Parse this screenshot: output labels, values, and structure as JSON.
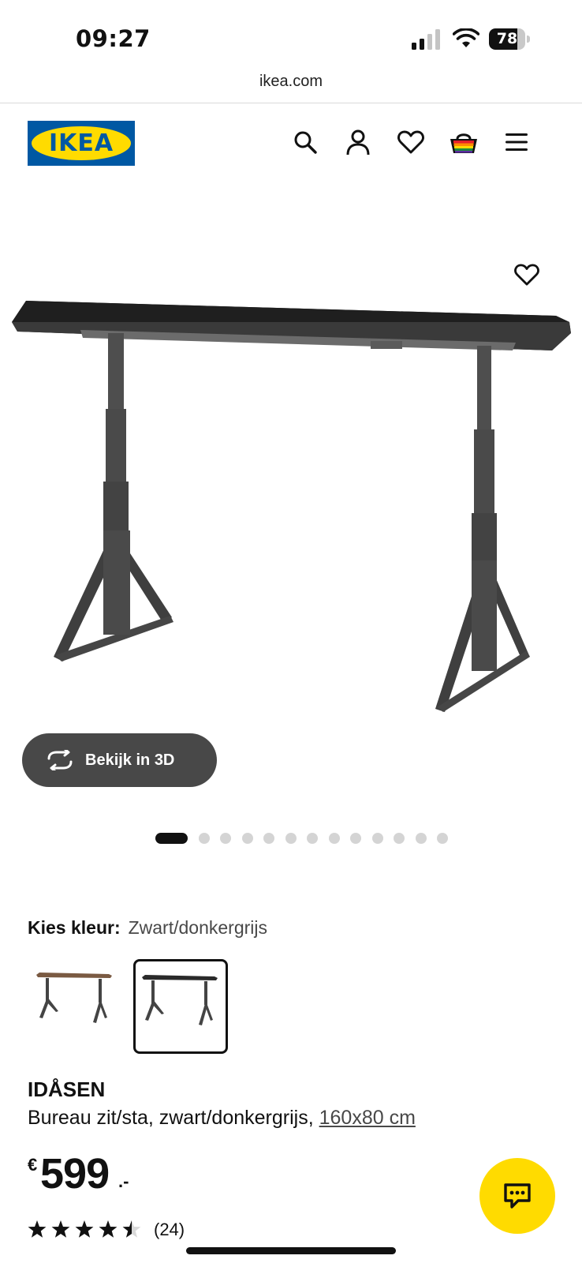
{
  "status": {
    "time": "09:27",
    "battery": "78",
    "battery_fraction": 0.78
  },
  "browser": {
    "url": "ikea.com"
  },
  "header": {
    "logo_text": "IKEA",
    "icons": [
      "search-icon",
      "account-icon",
      "heart-icon",
      "basket-icon",
      "menu-icon"
    ]
  },
  "gallery": {
    "view3d_label": "Bekijk in 3D",
    "image_count": 13,
    "active_index": 0
  },
  "color": {
    "label": "Kies kleur:",
    "value": "Zwart/donkergrijs",
    "options": [
      {
        "name": "Eiken/donkergrijs",
        "selected": false
      },
      {
        "name": "Zwart/donkergrijs",
        "selected": true
      }
    ]
  },
  "product": {
    "name": "IDÅSEN",
    "description": "Bureau zit/sta, zwart/donkergrijs,",
    "size": "160x80 cm",
    "price_currency": "€",
    "price_integer": "599",
    "price_decimal": ".-",
    "rating": 4.5,
    "rating_max": 5,
    "review_count": "(24)"
  },
  "colors": {
    "ikea_blue": "#0058a3",
    "ikea_yellow": "#ffdb00",
    "button_dark": "#484848"
  }
}
